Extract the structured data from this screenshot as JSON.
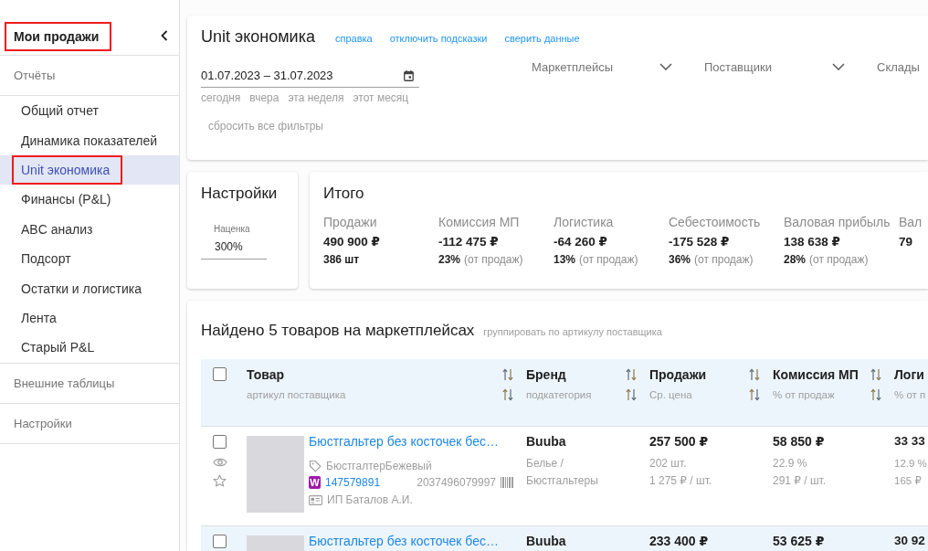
{
  "sidebar": {
    "title": {
      "text": "Мои продажи",
      "annotated": true
    },
    "sections": [
      {
        "label": "Отчёты",
        "items": [
          {
            "label": "Общий отчет",
            "selected": false,
            "annotated": false
          },
          {
            "label": "Динамика показателей",
            "selected": false,
            "annotated": false
          },
          {
            "label": "Unit экономика",
            "selected": true,
            "annotated": true
          },
          {
            "label": "Финансы (P&L)",
            "selected": false,
            "annotated": false
          },
          {
            "label": "ABC анализ",
            "selected": false,
            "annotated": false
          },
          {
            "label": "Подсорт",
            "selected": false,
            "annotated": false
          },
          {
            "label": "Остатки и логистика",
            "selected": false,
            "annotated": false
          },
          {
            "label": "Лента",
            "selected": false,
            "annotated": false
          },
          {
            "label": "Старый P&L",
            "selected": false,
            "annotated": false
          }
        ]
      },
      {
        "label": "Внешние таблицы"
      },
      {
        "label": "Настройки"
      }
    ]
  },
  "filter_panel": {
    "title": "Unit экономика",
    "links": [
      "справка",
      "отключить подсказки",
      "сверить данные"
    ],
    "date_range": {
      "value": "01.07.2023 – 31.07.2023"
    },
    "quick_dates": [
      "сегодня",
      "вчера",
      "эта неделя",
      "этот месяц"
    ],
    "reset": "сбросить все фильтры",
    "filters": [
      {
        "label": "Маркетплейсы",
        "caret": true
      },
      {
        "label": "Поставщики",
        "caret": true
      },
      {
        "label": "Склады",
        "caret": false
      }
    ]
  },
  "settings": {
    "title": "Настройки",
    "markup": {
      "label": "Наценка",
      "value": "300%"
    }
  },
  "totals": {
    "title": "Итого",
    "metrics": [
      {
        "label": "Продажи",
        "value": "490 900 ₽",
        "count": "386 шт"
      },
      {
        "label": "Комиссия МП",
        "value": "-112 475 ₽",
        "share": "23%",
        "note": "(от продаж)"
      },
      {
        "label": "Логистика",
        "value": "-64 260 ₽",
        "share": "13%",
        "note": "(от продаж)"
      },
      {
        "label": "Себестоимость",
        "value": "-175 528 ₽",
        "share": "36%",
        "note": "(от продаж)"
      },
      {
        "label": "Валовая прибыль",
        "value": "138 638 ₽",
        "share": "28%",
        "note": "(от продаж)"
      },
      {
        "label": "Вал",
        "value": "79"
      }
    ]
  },
  "products": {
    "title": "Найдено 5 товаров на маркетплейсах",
    "group_link": "группировать по артикулу поставщика",
    "select_all": {
      "checked": false
    },
    "columns": [
      {
        "title": "Товар",
        "subtitle": "артикул поставщика",
        "sortable": true
      },
      {
        "title": "Бренд",
        "subtitle": "подкатегория",
        "sortable": true
      },
      {
        "title": "Продажи",
        "subtitle": "Ср. цена",
        "sortable": true
      },
      {
        "title": "Комиссия МП",
        "subtitle": "% от продаж",
        "sortable": true
      },
      {
        "title": "Логи",
        "subtitle": "% от п"
      }
    ],
    "rows": [
      {
        "highlighted": false,
        "checked": false,
        "starred": false,
        "title": "Бюстгальтер без косточек бес…",
        "tag": "БюстгалтерБежевый",
        "marketplace": "W",
        "article": "147579891",
        "barcode": "2037496079997",
        "seller": "ИП Баталов А.И.",
        "brand": "Buuba",
        "category": "Белье / Бюстгальтеры",
        "sales": "257 500 ₽",
        "sales_qty": "202 шт.",
        "avg_price": "1 275 ₽ / шт.",
        "commission": "58 850 ₽",
        "commission_share": "22.9 %",
        "commission_unit": "291 ₽ / шт.",
        "logistics": "33 33",
        "logistics_share": "12.9 %",
        "logistics_unit": "165 ₽"
      },
      {
        "highlighted": true,
        "checked": false,
        "title": "Бюстгальтер без косточек бес…",
        "brand": "Buuba",
        "sales": "233 400 ₽",
        "commission": "53 625 ₽",
        "logistics": "30 92"
      }
    ]
  }
}
